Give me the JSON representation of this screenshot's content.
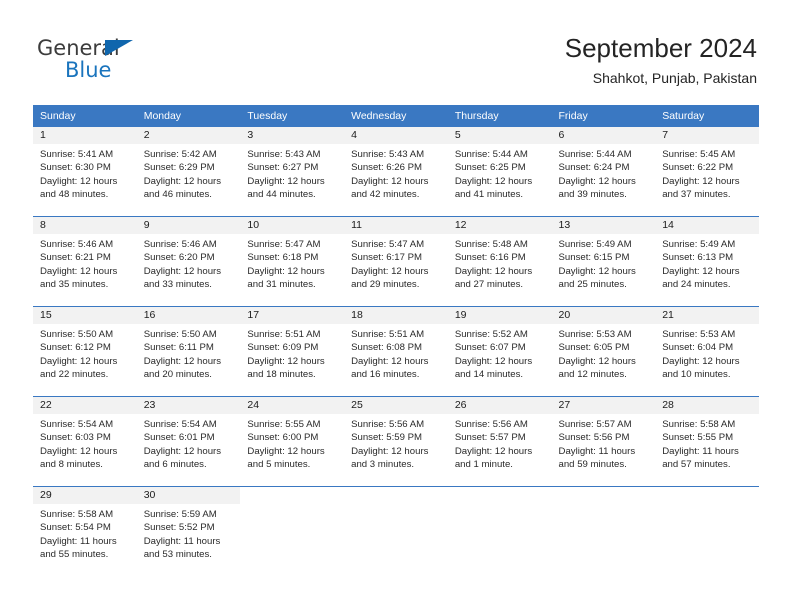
{
  "brand": {
    "name_part1": "General",
    "name_part2": "Blue",
    "logo_icon": "blue-triangle-logo"
  },
  "header": {
    "title": "September 2024",
    "subtitle": "Shahkot, Punjab, Pakistan"
  },
  "colors": {
    "header_blue": "#3a78c2",
    "brand_blue": "#1a74bd",
    "daynum_band": "#f2f2f2",
    "text": "#2a2a2a"
  },
  "calendar": {
    "weekday_headers": [
      "Sunday",
      "Monday",
      "Tuesday",
      "Wednesday",
      "Thursday",
      "Friday",
      "Saturday"
    ],
    "weeks": [
      [
        {
          "day": "1",
          "sunrise": "Sunrise: 5:41 AM",
          "sunset": "Sunset: 6:30 PM",
          "daylight_line1": "Daylight: 12 hours",
          "daylight_line2": "and 48 minutes."
        },
        {
          "day": "2",
          "sunrise": "Sunrise: 5:42 AM",
          "sunset": "Sunset: 6:29 PM",
          "daylight_line1": "Daylight: 12 hours",
          "daylight_line2": "and 46 minutes."
        },
        {
          "day": "3",
          "sunrise": "Sunrise: 5:43 AM",
          "sunset": "Sunset: 6:27 PM",
          "daylight_line1": "Daylight: 12 hours",
          "daylight_line2": "and 44 minutes."
        },
        {
          "day": "4",
          "sunrise": "Sunrise: 5:43 AM",
          "sunset": "Sunset: 6:26 PM",
          "daylight_line1": "Daylight: 12 hours",
          "daylight_line2": "and 42 minutes."
        },
        {
          "day": "5",
          "sunrise": "Sunrise: 5:44 AM",
          "sunset": "Sunset: 6:25 PM",
          "daylight_line1": "Daylight: 12 hours",
          "daylight_line2": "and 41 minutes."
        },
        {
          "day": "6",
          "sunrise": "Sunrise: 5:44 AM",
          "sunset": "Sunset: 6:24 PM",
          "daylight_line1": "Daylight: 12 hours",
          "daylight_line2": "and 39 minutes."
        },
        {
          "day": "7",
          "sunrise": "Sunrise: 5:45 AM",
          "sunset": "Sunset: 6:22 PM",
          "daylight_line1": "Daylight: 12 hours",
          "daylight_line2": "and 37 minutes."
        }
      ],
      [
        {
          "day": "8",
          "sunrise": "Sunrise: 5:46 AM",
          "sunset": "Sunset: 6:21 PM",
          "daylight_line1": "Daylight: 12 hours",
          "daylight_line2": "and 35 minutes."
        },
        {
          "day": "9",
          "sunrise": "Sunrise: 5:46 AM",
          "sunset": "Sunset: 6:20 PM",
          "daylight_line1": "Daylight: 12 hours",
          "daylight_line2": "and 33 minutes."
        },
        {
          "day": "10",
          "sunrise": "Sunrise: 5:47 AM",
          "sunset": "Sunset: 6:18 PM",
          "daylight_line1": "Daylight: 12 hours",
          "daylight_line2": "and 31 minutes."
        },
        {
          "day": "11",
          "sunrise": "Sunrise: 5:47 AM",
          "sunset": "Sunset: 6:17 PM",
          "daylight_line1": "Daylight: 12 hours",
          "daylight_line2": "and 29 minutes."
        },
        {
          "day": "12",
          "sunrise": "Sunrise: 5:48 AM",
          "sunset": "Sunset: 6:16 PM",
          "daylight_line1": "Daylight: 12 hours",
          "daylight_line2": "and 27 minutes."
        },
        {
          "day": "13",
          "sunrise": "Sunrise: 5:49 AM",
          "sunset": "Sunset: 6:15 PM",
          "daylight_line1": "Daylight: 12 hours",
          "daylight_line2": "and 25 minutes."
        },
        {
          "day": "14",
          "sunrise": "Sunrise: 5:49 AM",
          "sunset": "Sunset: 6:13 PM",
          "daylight_line1": "Daylight: 12 hours",
          "daylight_line2": "and 24 minutes."
        }
      ],
      [
        {
          "day": "15",
          "sunrise": "Sunrise: 5:50 AM",
          "sunset": "Sunset: 6:12 PM",
          "daylight_line1": "Daylight: 12 hours",
          "daylight_line2": "and 22 minutes."
        },
        {
          "day": "16",
          "sunrise": "Sunrise: 5:50 AM",
          "sunset": "Sunset: 6:11 PM",
          "daylight_line1": "Daylight: 12 hours",
          "daylight_line2": "and 20 minutes."
        },
        {
          "day": "17",
          "sunrise": "Sunrise: 5:51 AM",
          "sunset": "Sunset: 6:09 PM",
          "daylight_line1": "Daylight: 12 hours",
          "daylight_line2": "and 18 minutes."
        },
        {
          "day": "18",
          "sunrise": "Sunrise: 5:51 AM",
          "sunset": "Sunset: 6:08 PM",
          "daylight_line1": "Daylight: 12 hours",
          "daylight_line2": "and 16 minutes."
        },
        {
          "day": "19",
          "sunrise": "Sunrise: 5:52 AM",
          "sunset": "Sunset: 6:07 PM",
          "daylight_line1": "Daylight: 12 hours",
          "daylight_line2": "and 14 minutes."
        },
        {
          "day": "20",
          "sunrise": "Sunrise: 5:53 AM",
          "sunset": "Sunset: 6:05 PM",
          "daylight_line1": "Daylight: 12 hours",
          "daylight_line2": "and 12 minutes."
        },
        {
          "day": "21",
          "sunrise": "Sunrise: 5:53 AM",
          "sunset": "Sunset: 6:04 PM",
          "daylight_line1": "Daylight: 12 hours",
          "daylight_line2": "and 10 minutes."
        }
      ],
      [
        {
          "day": "22",
          "sunrise": "Sunrise: 5:54 AM",
          "sunset": "Sunset: 6:03 PM",
          "daylight_line1": "Daylight: 12 hours",
          "daylight_line2": "and 8 minutes."
        },
        {
          "day": "23",
          "sunrise": "Sunrise: 5:54 AM",
          "sunset": "Sunset: 6:01 PM",
          "daylight_line1": "Daylight: 12 hours",
          "daylight_line2": "and 6 minutes."
        },
        {
          "day": "24",
          "sunrise": "Sunrise: 5:55 AM",
          "sunset": "Sunset: 6:00 PM",
          "daylight_line1": "Daylight: 12 hours",
          "daylight_line2": "and 5 minutes."
        },
        {
          "day": "25",
          "sunrise": "Sunrise: 5:56 AM",
          "sunset": "Sunset: 5:59 PM",
          "daylight_line1": "Daylight: 12 hours",
          "daylight_line2": "and 3 minutes."
        },
        {
          "day": "26",
          "sunrise": "Sunrise: 5:56 AM",
          "sunset": "Sunset: 5:57 PM",
          "daylight_line1": "Daylight: 12 hours",
          "daylight_line2": "and 1 minute."
        },
        {
          "day": "27",
          "sunrise": "Sunrise: 5:57 AM",
          "sunset": "Sunset: 5:56 PM",
          "daylight_line1": "Daylight: 11 hours",
          "daylight_line2": "and 59 minutes."
        },
        {
          "day": "28",
          "sunrise": "Sunrise: 5:58 AM",
          "sunset": "Sunset: 5:55 PM",
          "daylight_line1": "Daylight: 11 hours",
          "daylight_line2": "and 57 minutes."
        }
      ],
      [
        {
          "day": "29",
          "sunrise": "Sunrise: 5:58 AM",
          "sunset": "Sunset: 5:54 PM",
          "daylight_line1": "Daylight: 11 hours",
          "daylight_line2": "and 55 minutes."
        },
        {
          "day": "30",
          "sunrise": "Sunrise: 5:59 AM",
          "sunset": "Sunset: 5:52 PM",
          "daylight_line1": "Daylight: 11 hours",
          "daylight_line2": "and 53 minutes."
        },
        {
          "day": "",
          "sunrise": "",
          "sunset": "",
          "daylight_line1": "",
          "daylight_line2": ""
        },
        {
          "day": "",
          "sunrise": "",
          "sunset": "",
          "daylight_line1": "",
          "daylight_line2": ""
        },
        {
          "day": "",
          "sunrise": "",
          "sunset": "",
          "daylight_line1": "",
          "daylight_line2": ""
        },
        {
          "day": "",
          "sunrise": "",
          "sunset": "",
          "daylight_line1": "",
          "daylight_line2": ""
        },
        {
          "day": "",
          "sunrise": "",
          "sunset": "",
          "daylight_line1": "",
          "daylight_line2": ""
        }
      ]
    ]
  }
}
